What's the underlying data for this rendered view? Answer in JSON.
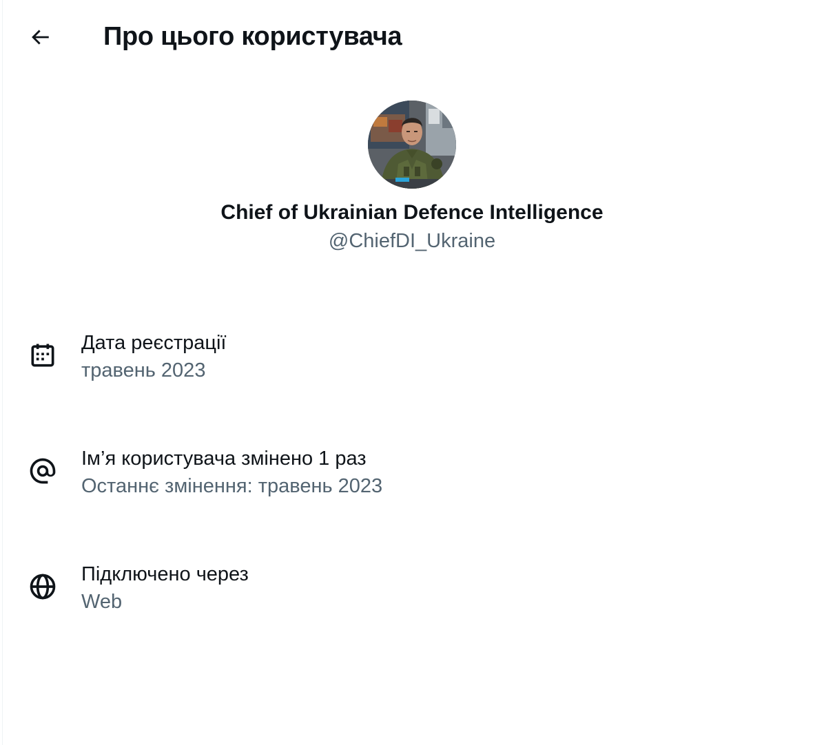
{
  "header": {
    "back_icon": "arrow-left-icon",
    "title": "Про цього користувача"
  },
  "profile": {
    "avatar_icon": "profile-photo",
    "display_name": "Chief of Ukrainian Defence Intelligence",
    "handle": "@ChiefDI_Ukraine"
  },
  "info": [
    {
      "icon": "calendar-icon",
      "label": "Дата реєстрації",
      "value": "травень 2023"
    },
    {
      "icon": "at-sign-icon",
      "label": "Ім’я користувача змінено 1 раз",
      "value": "Останнє змінення: травень 2023"
    },
    {
      "icon": "globe-icon",
      "label": "Підключено через",
      "value": "Web"
    }
  ],
  "colors": {
    "primary_text": "#0f1419",
    "secondary_text": "#536471",
    "border": "#eff3f4",
    "background": "#ffffff"
  }
}
